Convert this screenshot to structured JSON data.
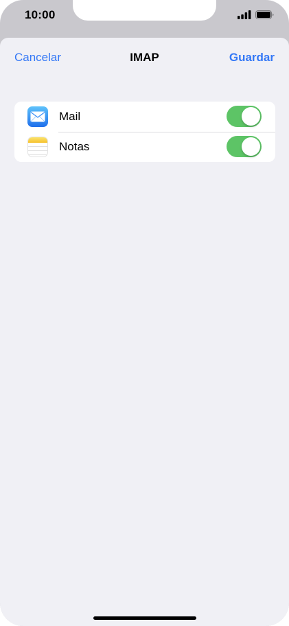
{
  "status_bar": {
    "time": "10:00",
    "icons": [
      "signal-icon",
      "battery-icon"
    ]
  },
  "nav": {
    "cancel_label": "Cancelar",
    "title": "IMAP",
    "save_label": "Guardar"
  },
  "accent_color": "#3478f6",
  "toggle_on_color": "#5dc466",
  "items": [
    {
      "label": "Mail",
      "icon": "mail-icon",
      "enabled": true
    },
    {
      "label": "Notas",
      "icon": "notes-icon",
      "enabled": true
    }
  ]
}
